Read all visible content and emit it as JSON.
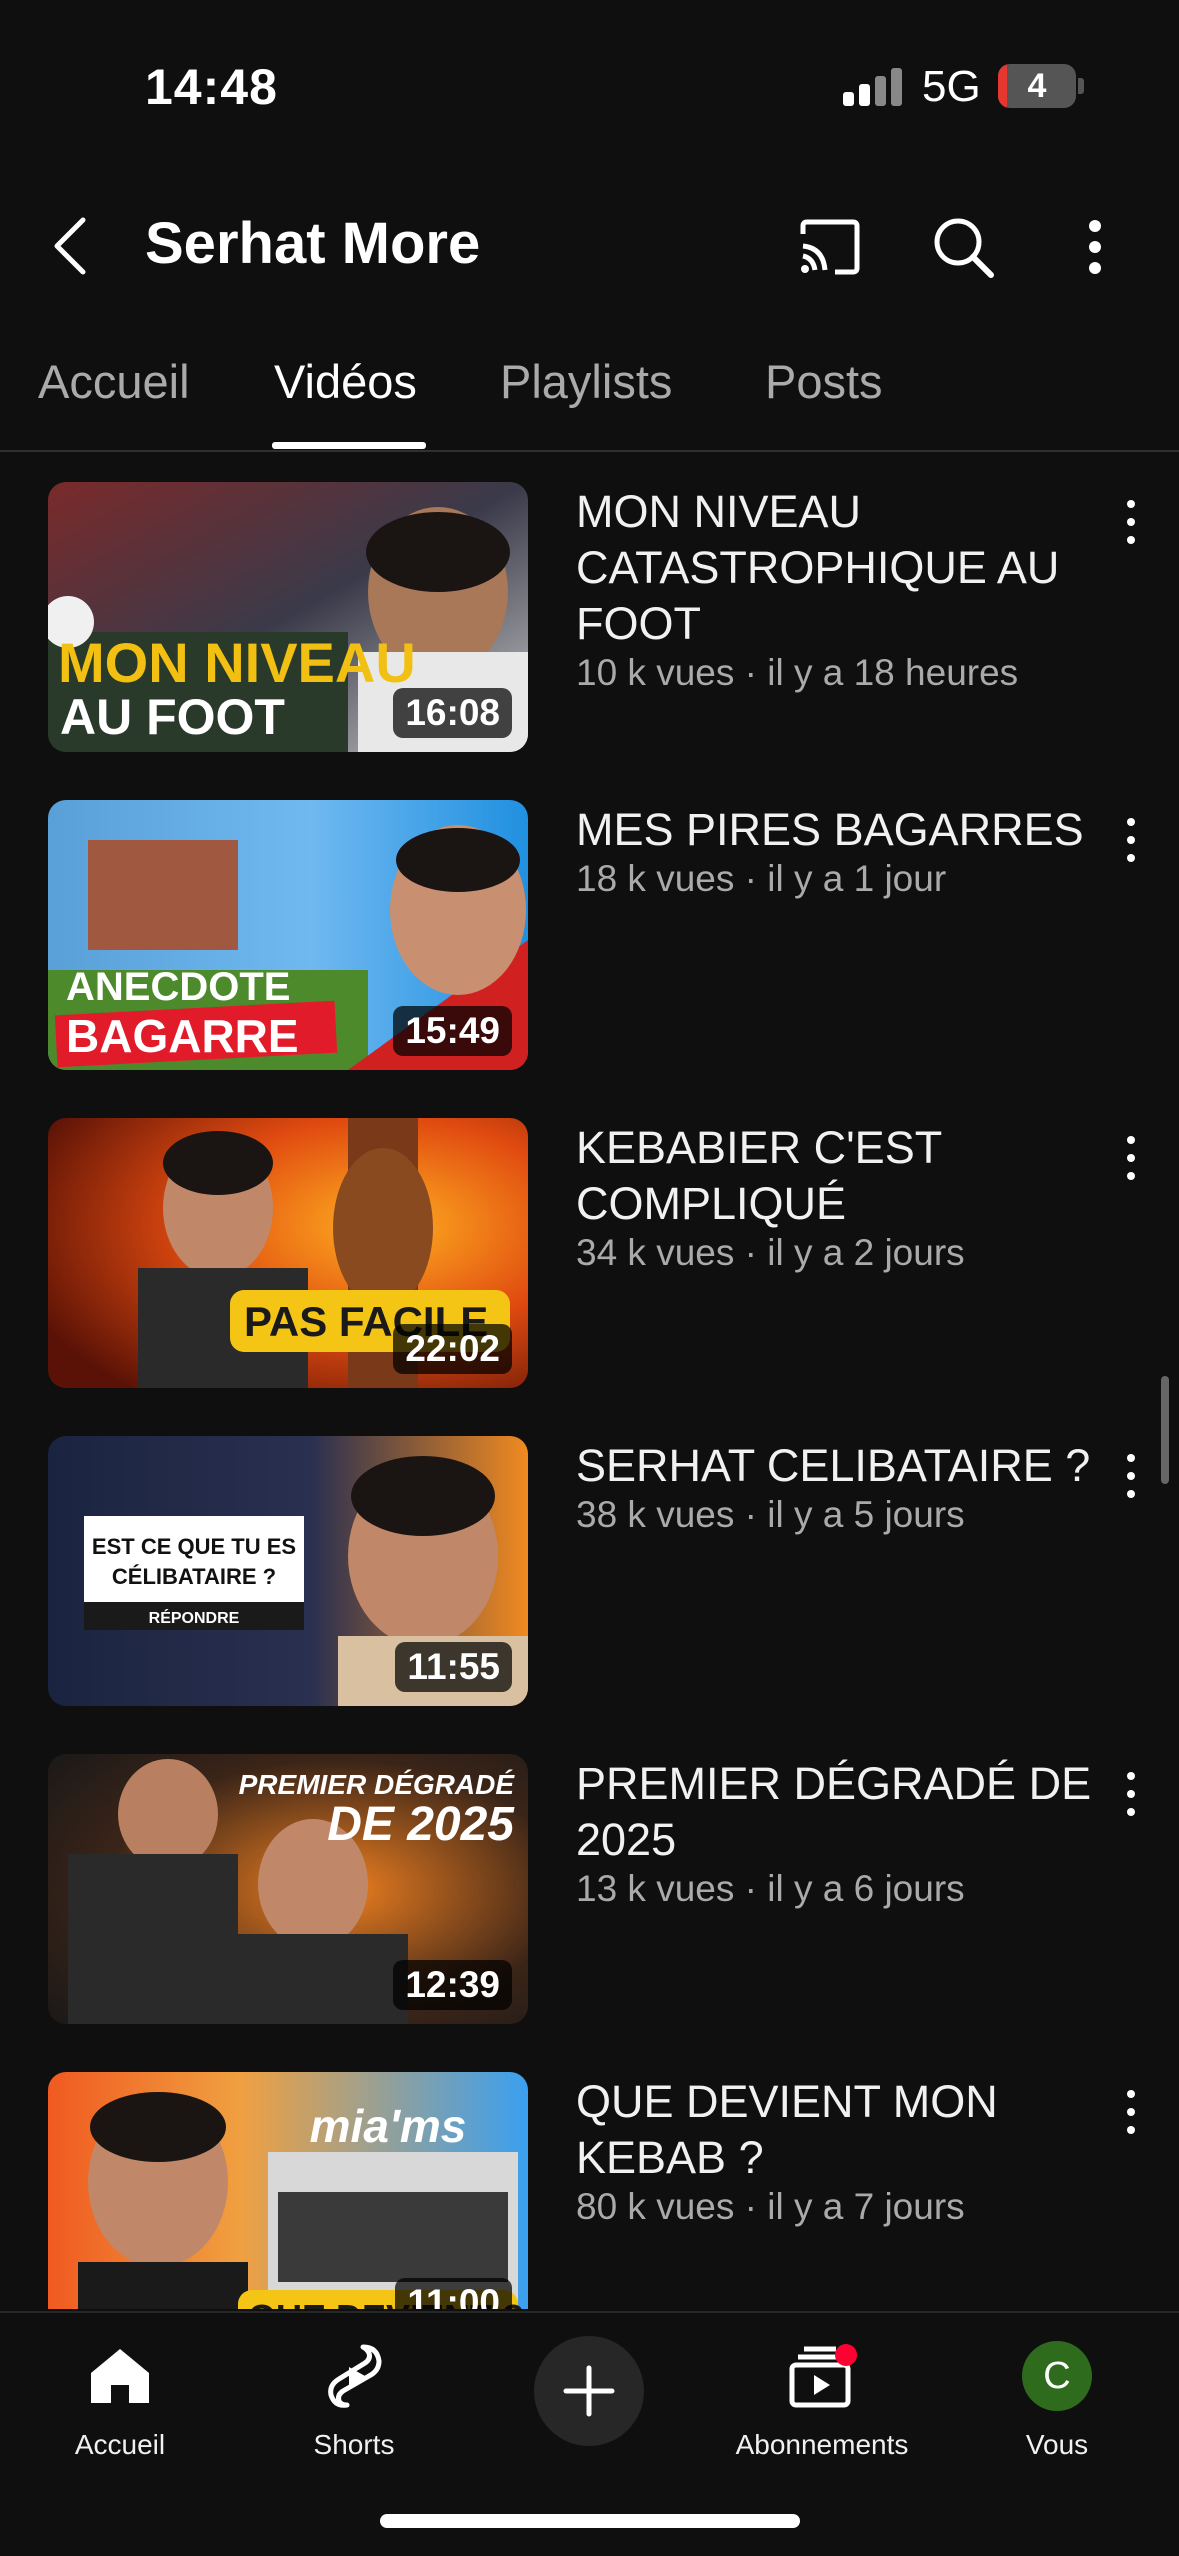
{
  "status_bar": {
    "time": "14:48",
    "network": "5G",
    "battery": "4"
  },
  "header": {
    "channel_name": "Serhat More"
  },
  "tabs": [
    {
      "label": "Accueil",
      "active": false
    },
    {
      "label": "Vidéos",
      "active": true
    },
    {
      "label": "Playlists",
      "active": false
    },
    {
      "label": "Posts",
      "active": false
    }
  ],
  "videos": [
    {
      "title": "MON NIVEAU CATASTROPHIQUE AU FOOT",
      "views": "10 k vues · il y a 18 heures",
      "duration": "16:08",
      "thumb_text": [
        "MON NIVEAU",
        "AU FOOT"
      ]
    },
    {
      "title": "MES PIRES BAGARRES",
      "views": "18 k vues · il y a 1 jour",
      "duration": "15:49",
      "thumb_text": [
        "ANECDOTE",
        "BAGARRE"
      ]
    },
    {
      "title": "KEBABIER C'EST COMPLIQUÉ",
      "views": "34 k vues · il y a 2 jours",
      "duration": "22:02",
      "thumb_text": [
        "PAS FACILE"
      ]
    },
    {
      "title": "SERHAT CELIBATAIRE ?",
      "views": "38 k vues · il y a 5 jours",
      "duration": "11:55",
      "thumb_text": [
        "EST CE QUE TU ES",
        "CÉLIBATAIRE ?",
        "RÉPONDRE"
      ]
    },
    {
      "title": "PREMIER DÉGRADÉ DE 2025",
      "views": "13 k vues · il y a 6 jours",
      "duration": "12:39",
      "thumb_text": [
        "PREMIER DÉGRADÉ",
        "DE 2025"
      ]
    },
    {
      "title": "QUE DEVIENT MON KEBAB ?",
      "views": "80 k vues · il y a 7 jours",
      "duration": "11:00",
      "thumb_text": [
        "mia'ms",
        "QUE DEVIENT ?"
      ]
    }
  ],
  "bottom_nav": {
    "home": "Accueil",
    "shorts": "Shorts",
    "subscriptions": "Abonnements",
    "you": "Vous",
    "avatar_letter": "C"
  },
  "colors": {
    "background": "#0f0f0f",
    "accent_red": "#ff0033",
    "avatar_green": "#2e6b1c"
  }
}
